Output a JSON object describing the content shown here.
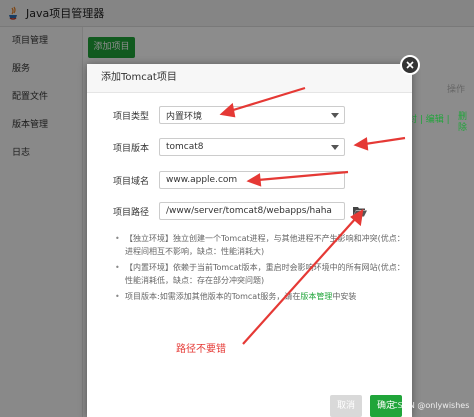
{
  "window": {
    "title": "Java项目管理器"
  },
  "sidebar": {
    "items": [
      "项目管理",
      "服务",
      "配置文件",
      "版本管理",
      "日志"
    ]
  },
  "main": {
    "add_button": "添加项目",
    "table_header_op": "操作",
    "row_links": "封 | 编辑 |",
    "row_delete": "删除"
  },
  "dialog": {
    "title": "添加Tomcat项目",
    "fields": {
      "type": {
        "label": "项目类型",
        "value": "内置环境"
      },
      "version": {
        "label": "项目版本",
        "value": "tomcat8"
      },
      "domain": {
        "label": "项目域名",
        "value": "www.apple.com"
      },
      "path": {
        "label": "项目路径",
        "value": "/www/server/tomcat8/webapps/haha"
      }
    },
    "tips": [
      "【独立环境】独立创建一个Tomcat进程，与其他进程不产生影响和冲突(优点：进程间相互不影响，缺点：性能消耗大)",
      "【内置环境】依赖于当前Tomcat版本，重启时会影响环境中的所有网站(优点：性能消耗低，缺点：存在部分冲突问题)"
    ],
    "tip3_prefix": "项目版本:如需添加其他版本的Tomcat服务，请在",
    "tip3_link": "版本管理",
    "tip3_suffix": "中安装",
    "cancel": "取消",
    "confirm": "确定"
  },
  "annotation": "路径不要错",
  "watermark": "CSDN @onlywishes",
  "colors": {
    "accent": "#20a53a",
    "annotation": "#e53935"
  }
}
